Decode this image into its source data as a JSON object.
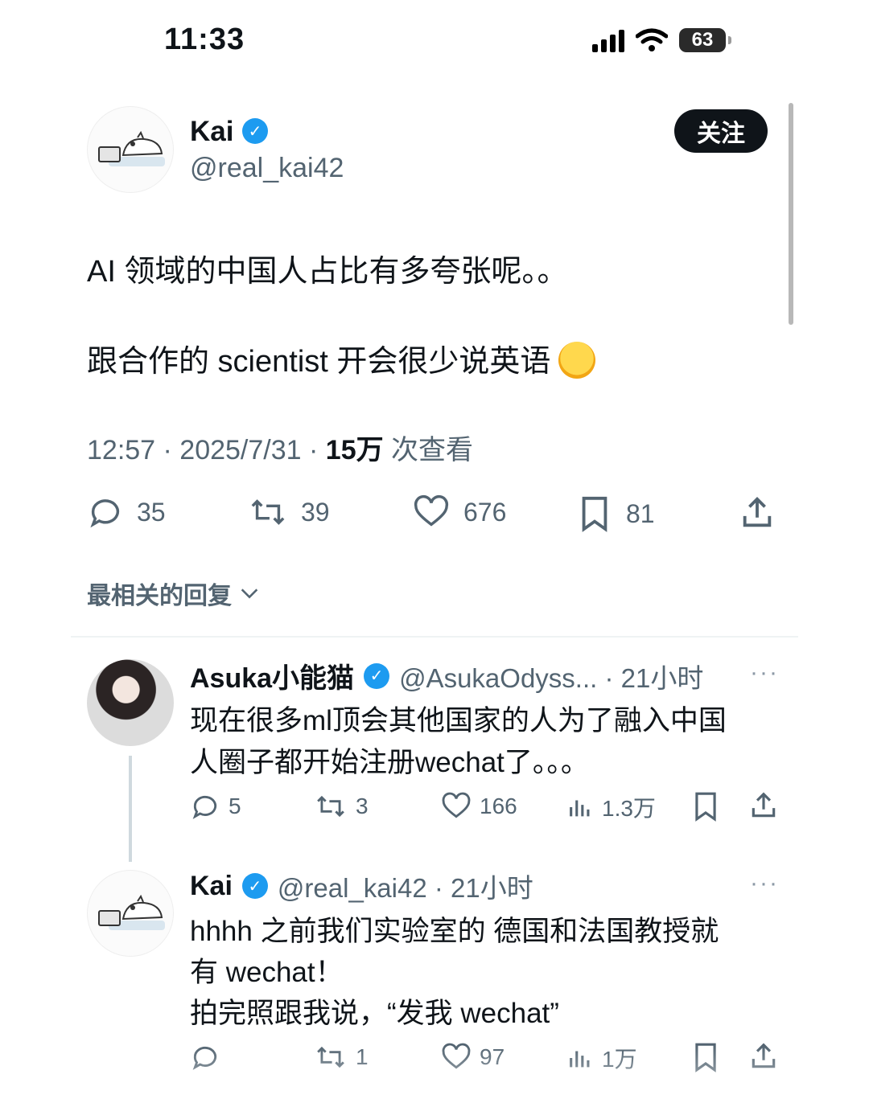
{
  "status_bar": {
    "time": "11:33",
    "battery": "63"
  },
  "tweet": {
    "author": {
      "name": "Kai",
      "handle": "@real_kai42"
    },
    "follow_label": "关注",
    "text_line1": "AI 领域的中国人占比有多夸张呢。。",
    "text_line2": "跟合作的 scientist 开会很少说英语",
    "meta": {
      "time_date": "12:57 · 2025/7/31 · ",
      "views_count": "15万",
      "views_label": " 次查看"
    },
    "stats": {
      "replies": "35",
      "retweets": "39",
      "likes": "676",
      "bookmarks": "81"
    }
  },
  "replies_sort_label": "最相关的回复",
  "replies": [
    {
      "name": "Asuka小能猫",
      "handle_time": "@AsukaOdyss... · 21小时",
      "more": "···",
      "lines": [
        "现在很多ml顶会其他国家的人为了融入中国",
        "人圈子都开始注册wechat了。。。"
      ],
      "stats": {
        "replies": "5",
        "retweets": "3",
        "likes": "166",
        "views": "1.3万"
      }
    },
    {
      "name": "Kai",
      "handle_time": "@real_kai42 · 21小时",
      "more": "···",
      "lines": [
        "hhhh 之前我们实验室的 德国和法国教授就",
        "有 wechat！",
        "拍完照跟我说，“发我 wechat”"
      ],
      "stats": {
        "replies": "",
        "retweets": "1",
        "likes": "97",
        "views": "1万"
      }
    }
  ],
  "colors": {
    "verified": "#1d9bf0",
    "text": "#0f1419",
    "secondary": "#536471"
  },
  "icons": [
    "signal-icon",
    "wifi-icon",
    "battery-icon",
    "verified-icon",
    "reply-icon",
    "retweet-icon",
    "like-icon",
    "bookmark-icon",
    "share-icon",
    "views-icon",
    "chevron-down-icon"
  ]
}
